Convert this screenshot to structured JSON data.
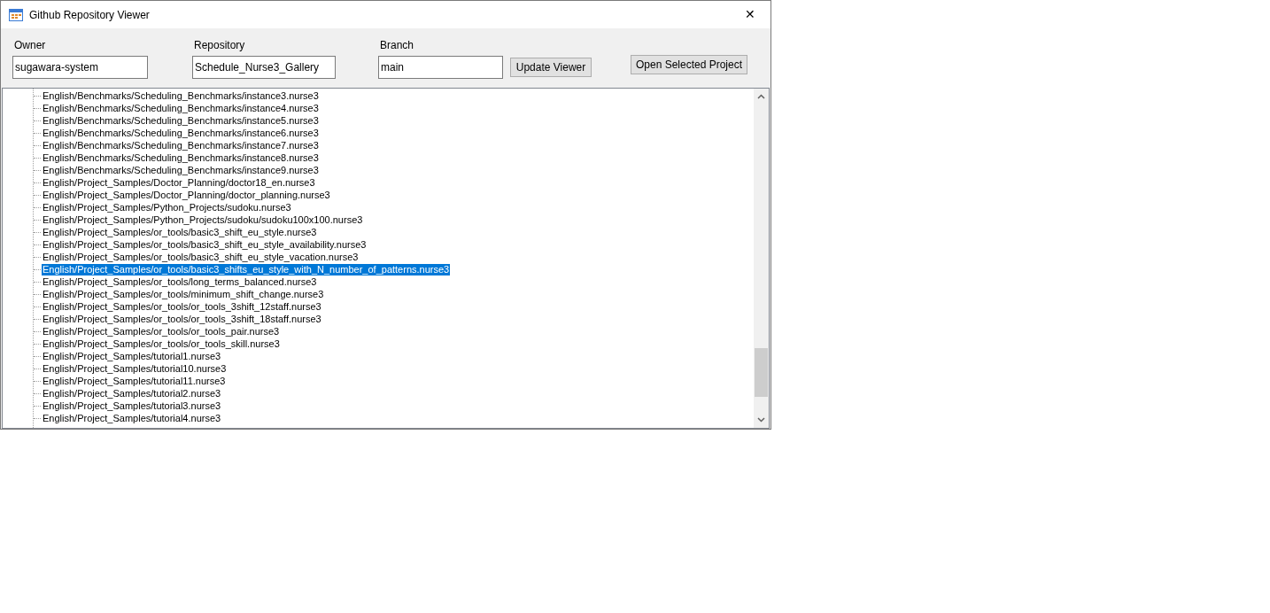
{
  "window": {
    "title": "Github Repository Viewer",
    "close": "✕"
  },
  "fields": [
    {
      "label": "Owner",
      "value": "sugawara-system"
    },
    {
      "label": "Repository",
      "value": "Schedule_Nurse3_Gallery"
    },
    {
      "label": "Branch",
      "value": "main"
    }
  ],
  "buttons": {
    "update": "Update Viewer",
    "open": "Open Selected Project"
  },
  "tree": {
    "items": [
      {
        "path": "English/Benchmarks/Scheduling_Benchmarks/instance3.nurse3",
        "selected": false
      },
      {
        "path": "English/Benchmarks/Scheduling_Benchmarks/instance4.nurse3",
        "selected": false
      },
      {
        "path": "English/Benchmarks/Scheduling_Benchmarks/instance5.nurse3",
        "selected": false
      },
      {
        "path": "English/Benchmarks/Scheduling_Benchmarks/instance6.nurse3",
        "selected": false
      },
      {
        "path": "English/Benchmarks/Scheduling_Benchmarks/instance7.nurse3",
        "selected": false
      },
      {
        "path": "English/Benchmarks/Scheduling_Benchmarks/instance8.nurse3",
        "selected": false
      },
      {
        "path": "English/Benchmarks/Scheduling_Benchmarks/instance9.nurse3",
        "selected": false
      },
      {
        "path": "English/Project_Samples/Doctor_Planning/doctor18_en.nurse3",
        "selected": false
      },
      {
        "path": "English/Project_Samples/Doctor_Planning/doctor_planning.nurse3",
        "selected": false
      },
      {
        "path": "English/Project_Samples/Python_Projects/sudoku.nurse3",
        "selected": false
      },
      {
        "path": "English/Project_Samples/Python_Projects/sudoku/sudoku100x100.nurse3",
        "selected": false
      },
      {
        "path": "English/Project_Samples/or_tools/basic3_shift_eu_style.nurse3",
        "selected": false
      },
      {
        "path": "English/Project_Samples/or_tools/basic3_shift_eu_style_availability.nurse3",
        "selected": false
      },
      {
        "path": "English/Project_Samples/or_tools/basic3_shift_eu_style_vacation.nurse3",
        "selected": false
      },
      {
        "path": "English/Project_Samples/or_tools/basic3_shifts_eu_style_with_N_number_of_patterns.nurse3",
        "selected": true
      },
      {
        "path": "English/Project_Samples/or_tools/long_terms_balanced.nurse3",
        "selected": false
      },
      {
        "path": "English/Project_Samples/or_tools/minimum_shift_change.nurse3",
        "selected": false
      },
      {
        "path": "English/Project_Samples/or_tools/or_tools_3shift_12staff.nurse3",
        "selected": false
      },
      {
        "path": "English/Project_Samples/or_tools/or_tools_3shift_18staff.nurse3",
        "selected": false
      },
      {
        "path": "English/Project_Samples/or_tools/or_tools_pair.nurse3",
        "selected": false
      },
      {
        "path": "English/Project_Samples/or_tools/or_tools_skill.nurse3",
        "selected": false
      },
      {
        "path": "English/Project_Samples/tutorial1.nurse3",
        "selected": false
      },
      {
        "path": "English/Project_Samples/tutorial10.nurse3",
        "selected": false
      },
      {
        "path": "English/Project_Samples/tutorial11.nurse3",
        "selected": false
      },
      {
        "path": "English/Project_Samples/tutorial2.nurse3",
        "selected": false
      },
      {
        "path": "English/Project_Samples/tutorial3.nurse3",
        "selected": false
      },
      {
        "path": "English/Project_Samples/tutorial4.nurse3",
        "selected": false
      }
    ]
  }
}
